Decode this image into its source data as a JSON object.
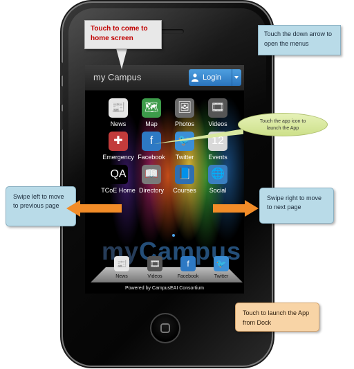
{
  "screen": {
    "brand": "my Campus",
    "login_label": "Login",
    "apps": [
      {
        "label": "News",
        "icon": "newspaper-icon",
        "glyph": "📰",
        "color": "#e6e6e6"
      },
      {
        "label": "Map",
        "icon": "map-icon",
        "glyph": "🗺",
        "color": "#3d9b4a"
      },
      {
        "label": "Photos",
        "icon": "photos-icon",
        "glyph": "🖼",
        "color": "#6a6a6a"
      },
      {
        "label": "Videos",
        "icon": "film-reel-icon",
        "glyph": "🎞",
        "color": "#555555"
      },
      {
        "label": "Emergency",
        "icon": "first-aid-kit-icon",
        "glyph": "✚",
        "color": "#c23b3b"
      },
      {
        "label": "Facebook",
        "icon": "facebook-cup-icon",
        "glyph": "f",
        "color": "#2d79c4"
      },
      {
        "label": "Twitter",
        "icon": "twitter-bird-icon",
        "glyph": "🐦",
        "color": "#3b8fd6"
      },
      {
        "label": "Events",
        "icon": "calendar-icon",
        "glyph": "12",
        "color": "#d9d9d9"
      },
      {
        "label": "TCoE Home",
        "icon": "qa-icon",
        "glyph": "QA",
        "color": "#000000"
      },
      {
        "label": "Directory",
        "icon": "directory-book-icon",
        "glyph": "📖",
        "color": "#7a7a7a"
      },
      {
        "label": "Courses",
        "icon": "courses-book-icon",
        "glyph": "📘",
        "color": "#2f6fb0"
      },
      {
        "label": "Social",
        "icon": "social-globe-icon",
        "glyph": "🌐",
        "color": "#3a7fc0"
      }
    ],
    "watermark_a": "my",
    "watermark_b": "Campus",
    "dock": [
      {
        "label": "News",
        "icon": "newspaper-icon",
        "glyph": "📰",
        "color": "#e6e6e6"
      },
      {
        "label": "Videos",
        "icon": "film-reel-icon",
        "glyph": "🎞",
        "color": "#555555"
      },
      {
        "label": "Facebook",
        "icon": "facebook-cup-icon",
        "glyph": "f",
        "color": "#2d79c4"
      },
      {
        "label": "Twitter",
        "icon": "twitter-bird-icon",
        "glyph": "🐦",
        "color": "#3b8fd6"
      }
    ],
    "footer": "Powered by CampusEAI Consortium"
  },
  "callouts": {
    "home": "Touch to come to home screen",
    "menus": "Touch the down arrow to open the menus",
    "app_icon": "Touch the app icon to launch the App",
    "swipe_left": "Swipe left to move to previous page",
    "swipe_right": "Swipe right to move to next page",
    "dock": "Touch to launch the App from Dock"
  },
  "colors": {
    "login_button": "#3a8bd6",
    "callout_red_text": "#c00000",
    "callout_blue": "#b9dbe8",
    "callout_orange": "#f8d4a6",
    "callout_green": "#d8e8a0",
    "swipe_arrow": "#f28c28"
  }
}
